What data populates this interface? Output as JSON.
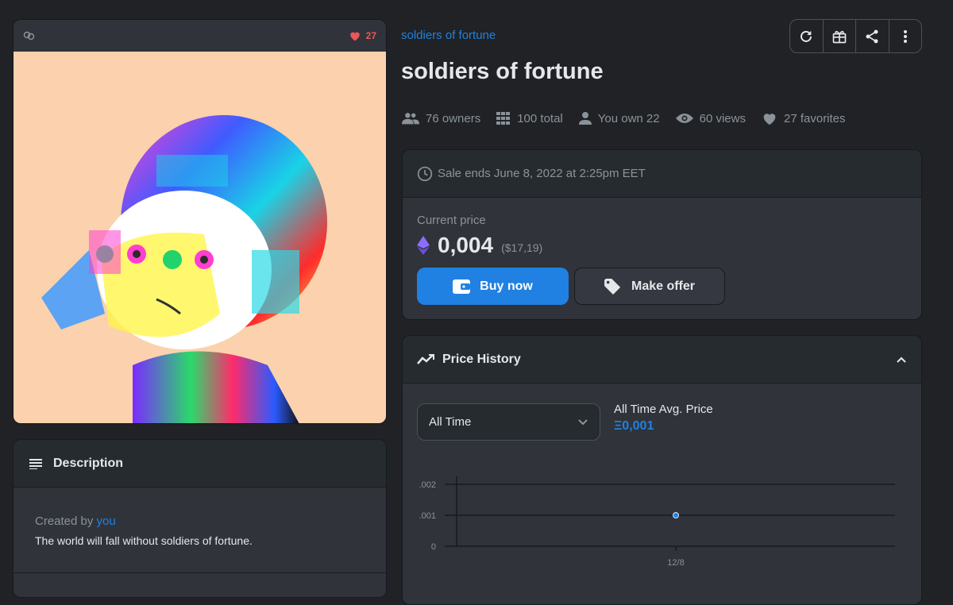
{
  "asset_card": {
    "favorites_count": "27"
  },
  "description": {
    "heading": "Description",
    "created_by_prefix": "Created by",
    "creator": "you",
    "text": "The world will fall without soldiers of fortune."
  },
  "header": {
    "collection": "soldiers of fortune",
    "title": "soldiers of fortune"
  },
  "toolbar": {
    "icons": [
      "refresh-icon",
      "gift-icon",
      "share-icon",
      "more-icon"
    ]
  },
  "stats": {
    "owners": "76 owners",
    "total": "100 total",
    "you_own": "You own 22",
    "views": "60 views",
    "favorites": "27 favorites"
  },
  "sale": {
    "ends": "Sale ends June 8, 2022 at 2:25pm EET",
    "current_price_label": "Current price",
    "price": "0,004",
    "price_usd": "($17,19)",
    "buy_label": "Buy now",
    "offer_label": "Make offer"
  },
  "price_history": {
    "heading": "Price History",
    "range": "All Time",
    "avg_label": "All Time Avg. Price",
    "avg_value": "Ξ0,001"
  },
  "colors": {
    "accent": "#2081e2",
    "favorite": "#eb5757",
    "background": "#202225"
  },
  "chart_data": {
    "type": "scatter",
    "x": [
      "12/8"
    ],
    "y": [
      0.001
    ],
    "yticks": [
      ".002",
      ".001",
      "0"
    ],
    "ylim": [
      0,
      0.002
    ],
    "grid": true
  }
}
